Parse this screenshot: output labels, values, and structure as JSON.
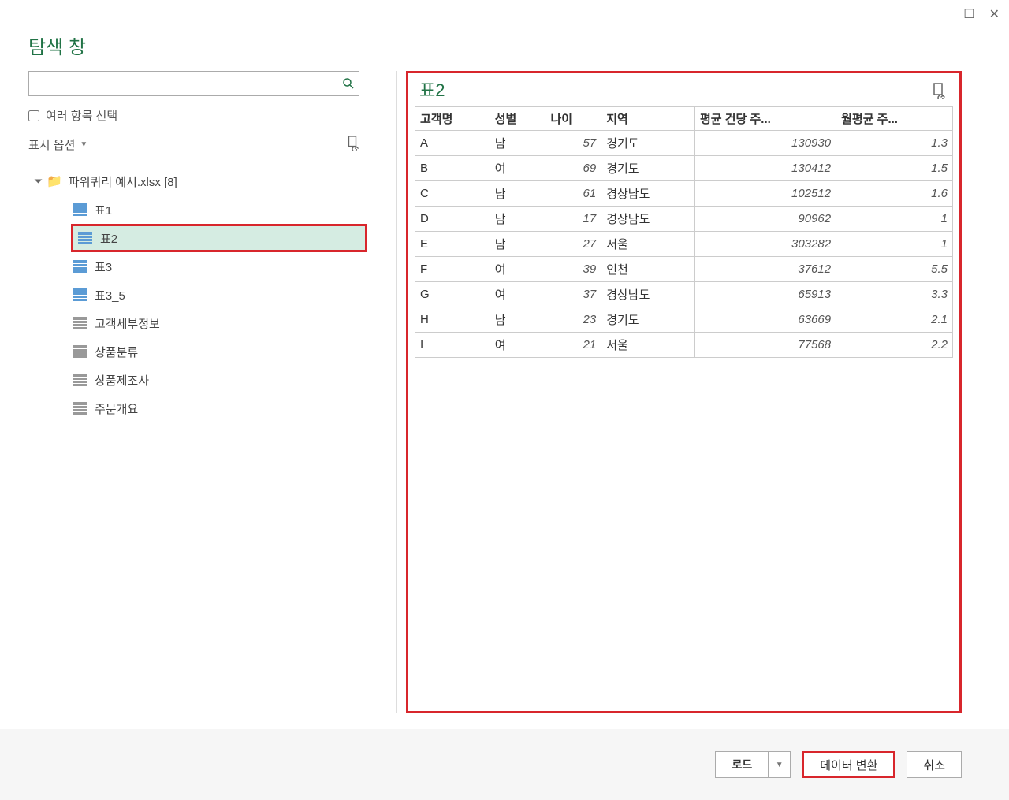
{
  "window": {
    "title": "탐색 창"
  },
  "sidebar": {
    "search_placeholder": "",
    "multi_select_label": "여러 항목 선택",
    "display_options_label": "표시 옵션",
    "root_label": "파워쿼리 예시.xlsx [8]",
    "items": [
      {
        "label": "표1",
        "icon": "blue",
        "selected": false
      },
      {
        "label": "표2",
        "icon": "blue",
        "selected": true
      },
      {
        "label": "표3",
        "icon": "blue",
        "selected": false
      },
      {
        "label": "표3_5",
        "icon": "blue",
        "selected": false
      },
      {
        "label": "고객세부정보",
        "icon": "gray",
        "selected": false
      },
      {
        "label": "상품분류",
        "icon": "gray",
        "selected": false
      },
      {
        "label": "상품제조사",
        "icon": "gray",
        "selected": false
      },
      {
        "label": "주문개요",
        "icon": "gray",
        "selected": false
      }
    ]
  },
  "preview": {
    "title": "표2",
    "columns": [
      "고객명",
      "성별",
      "나이",
      "지역",
      "평균 건당 주...",
      "월평균 주..."
    ],
    "column_types": [
      "text",
      "text",
      "num",
      "text",
      "num",
      "num"
    ],
    "rows": [
      [
        "A",
        "남",
        "57",
        "경기도",
        "130930",
        "1.3"
      ],
      [
        "B",
        "여",
        "69",
        "경기도",
        "130412",
        "1.5"
      ],
      [
        "C",
        "남",
        "61",
        "경상남도",
        "102512",
        "1.6"
      ],
      [
        "D",
        "남",
        "17",
        "경상남도",
        "90962",
        "1"
      ],
      [
        "E",
        "남",
        "27",
        "서울",
        "303282",
        "1"
      ],
      [
        "F",
        "여",
        "39",
        "인천",
        "37612",
        "5.5"
      ],
      [
        "G",
        "여",
        "37",
        "경상남도",
        "65913",
        "3.3"
      ],
      [
        "H",
        "남",
        "23",
        "경기도",
        "63669",
        "2.1"
      ],
      [
        "I",
        "여",
        "21",
        "서울",
        "77568",
        "2.2"
      ]
    ]
  },
  "footer": {
    "load_label": "로드",
    "transform_label": "데이터 변환",
    "cancel_label": "취소"
  }
}
